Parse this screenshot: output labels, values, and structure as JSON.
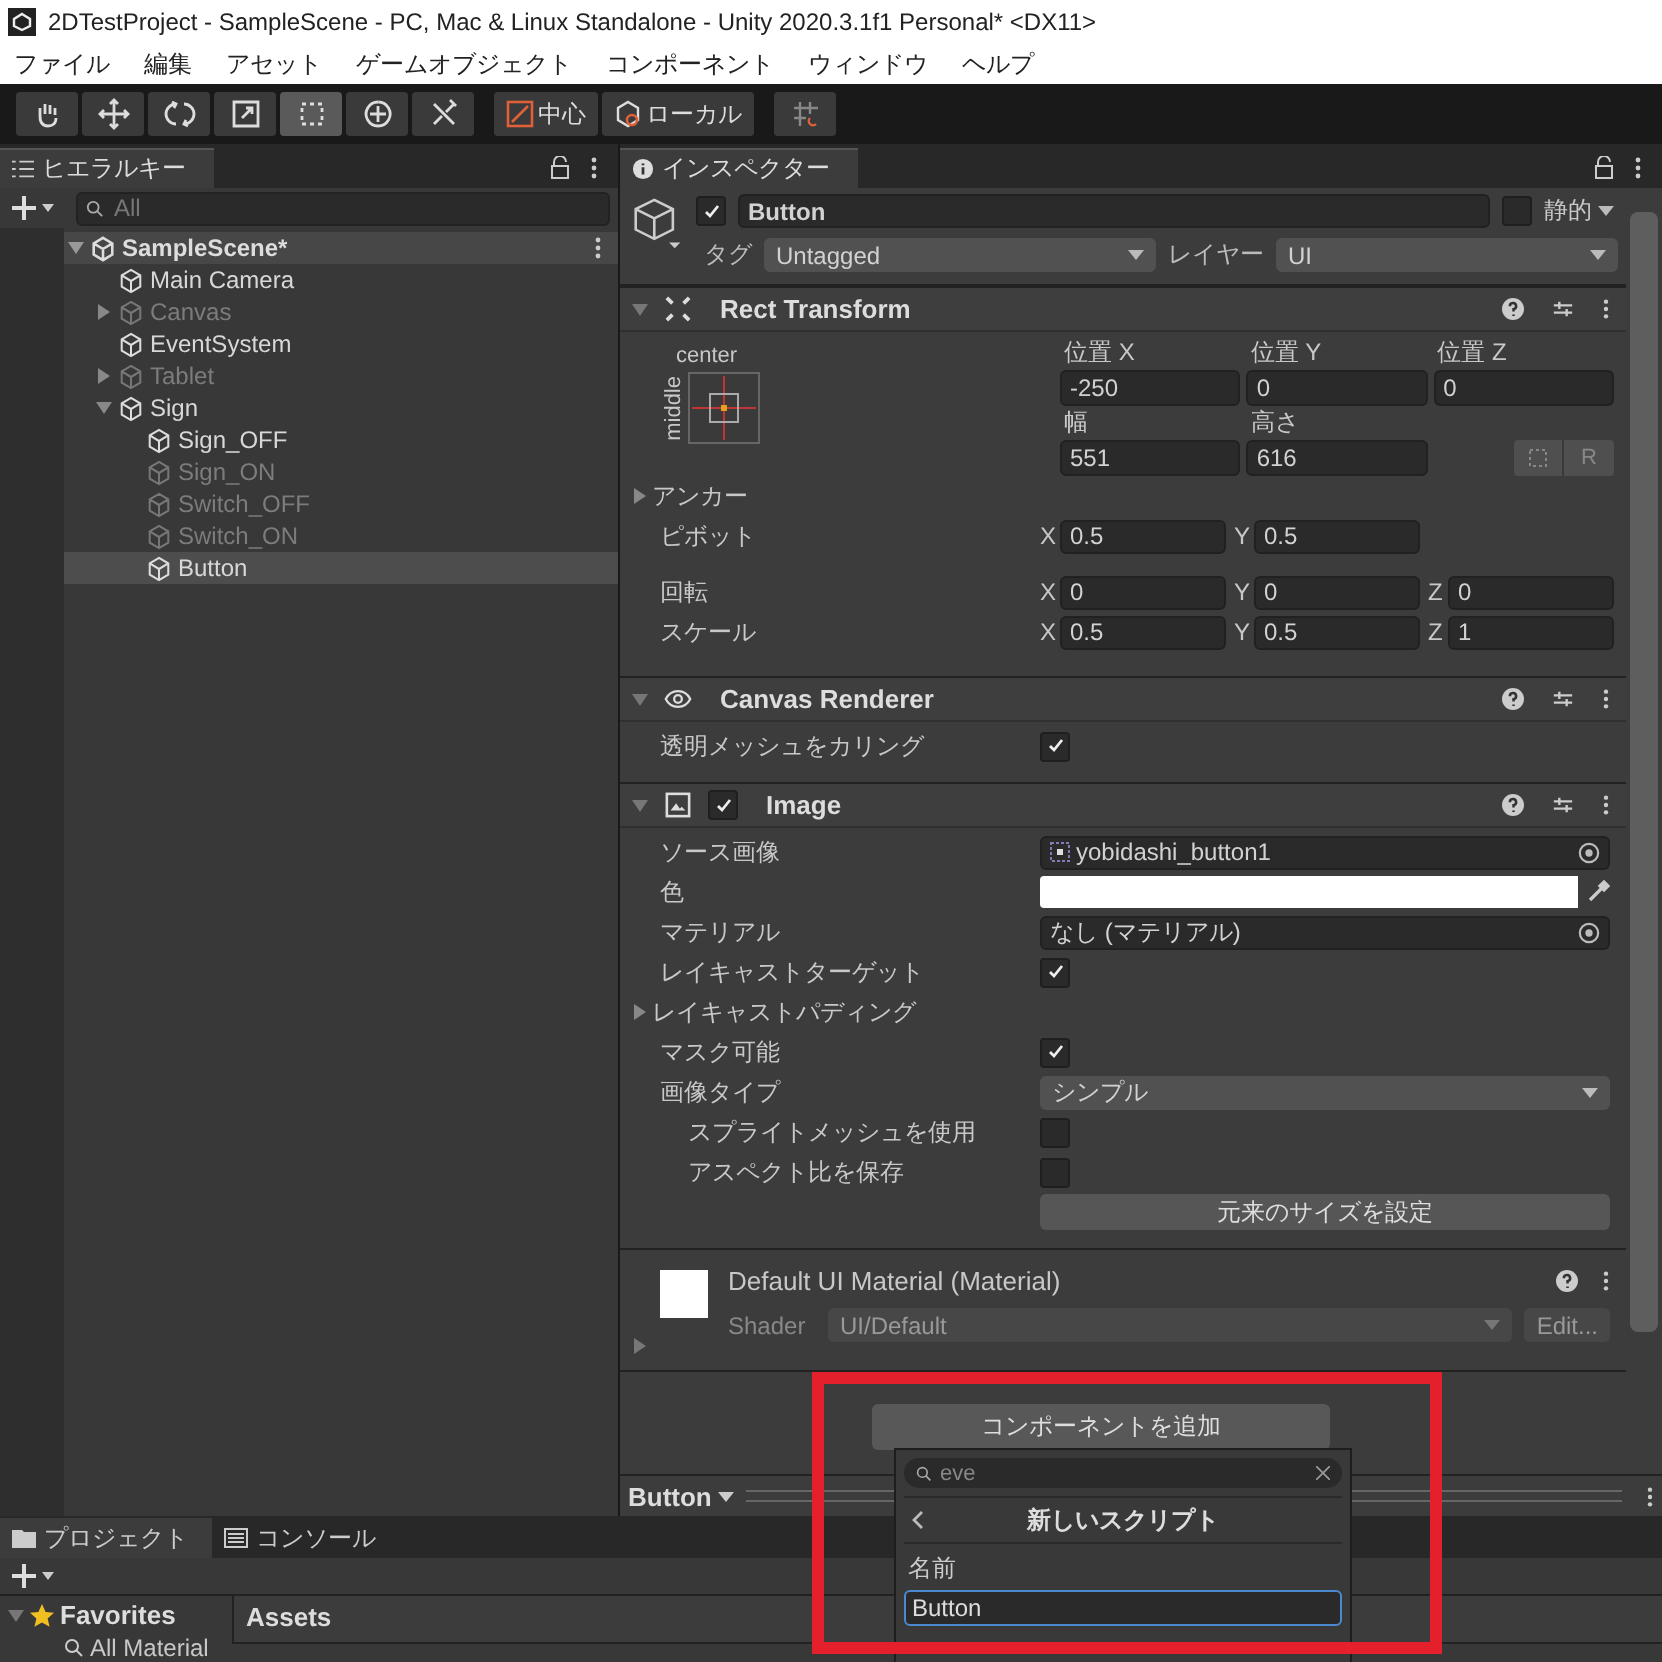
{
  "window": {
    "title": "2DTestProject - SampleScene - PC, Mac & Linux Standalone - Unity 2020.3.1f1 Personal* <DX11>"
  },
  "menu": [
    "ファイル",
    "編集",
    "アセット",
    "ゲームオブジェクト",
    "コンポーネント",
    "ウィンドウ",
    "ヘルプ"
  ],
  "toolbar": {
    "tools": [
      {
        "kind": "hand",
        "selected": false
      },
      {
        "kind": "move",
        "selected": false
      },
      {
        "kind": "rotate",
        "selected": false
      },
      {
        "kind": "scale",
        "selected": false
      },
      {
        "kind": "rect",
        "selected": true
      },
      {
        "kind": "transform",
        "selected": false
      },
      {
        "kind": "custom",
        "selected": false
      }
    ],
    "pivot": [
      {
        "kind": "pivot",
        "label": "中心"
      },
      {
        "kind": "local",
        "label": "ローカル"
      }
    ]
  },
  "hierarchy": {
    "tab": "ヒエラルキー",
    "search": {
      "placeholder": "All"
    },
    "scene": {
      "name": "SampleScene*",
      "expanded": true
    },
    "items": [
      {
        "name": "Main Camera",
        "active": true,
        "selected": false
      },
      {
        "name": "Canvas",
        "active": false,
        "selected": false,
        "expanded": false
      },
      {
        "name": "EventSystem",
        "active": true,
        "selected": false
      },
      {
        "name": "Tablet",
        "active": false,
        "selected": false,
        "expanded": false
      },
      {
        "name": "Sign",
        "active": true,
        "selected": false,
        "expanded": true,
        "children": [
          {
            "name": "Sign_OFF",
            "active": true,
            "selected": false
          },
          {
            "name": "Sign_ON",
            "active": false,
            "selected": false
          },
          {
            "name": "Switch_OFF",
            "active": false,
            "selected": false
          },
          {
            "name": "Switch_ON",
            "active": false,
            "selected": false
          },
          {
            "name": "Button",
            "active": true,
            "selected": true
          }
        ]
      }
    ]
  },
  "inspector": {
    "tab": "インスペクター",
    "object": {
      "name": "Button",
      "active": true,
      "static": false,
      "static_label": "静的",
      "tag_label": "タグ",
      "tag": "Untagged",
      "layer_label": "レイヤー",
      "layer": "UI"
    },
    "components": [
      {
        "kind": "rect_transform",
        "title": "Rect Transform",
        "expanded": true,
        "anchor": {
          "horizontal": "center",
          "vertical": "middle"
        },
        "position": [
          {
            "label": "位置 X",
            "value": "-250"
          },
          {
            "label": "位置 Y",
            "value": "0"
          },
          {
            "label": "位置 Z",
            "value": "0"
          }
        ],
        "size": [
          {
            "label": "幅",
            "value": "551"
          },
          {
            "label": "高さ",
            "value": "616"
          }
        ],
        "raw_button": "R",
        "rows": [
          {
            "kind": "foldout",
            "label": "アンカー"
          },
          {
            "kind": "vector",
            "label": "ピボット",
            "values": [
              {
                "axis": "X",
                "value": "0.5"
              },
              {
                "axis": "Y",
                "value": "0.5"
              }
            ]
          },
          {
            "kind": "vector",
            "label": "回転",
            "values": [
              {
                "axis": "X",
                "value": "0"
              },
              {
                "axis": "Y",
                "value": "0"
              },
              {
                "axis": "Z",
                "value": "0"
              }
            ]
          },
          {
            "kind": "vector",
            "label": "スケール",
            "values": [
              {
                "axis": "X",
                "value": "0.5"
              },
              {
                "axis": "Y",
                "value": "0.5"
              },
              {
                "axis": "Z",
                "value": "1"
              }
            ]
          }
        ]
      },
      {
        "kind": "canvas_renderer",
        "title": "Canvas Renderer",
        "expanded": true,
        "properties": [
          {
            "kind": "checkbox",
            "label": "透明メッシュをカリング",
            "checked": true,
            "indented": false
          }
        ]
      },
      {
        "kind": "image",
        "title": "Image",
        "expanded": true,
        "enabled": true,
        "properties": [
          {
            "kind": "object",
            "label": "ソース画像",
            "value": "yobidashi_button1",
            "sprite": true,
            "indented": false
          },
          {
            "kind": "color",
            "label": "色",
            "color": "#ffffff",
            "indented": false
          },
          {
            "kind": "object",
            "label": "マテリアル",
            "value": "なし (マテリアル)",
            "sprite": false,
            "indented": false
          },
          {
            "kind": "checkbox",
            "label": "レイキャストターゲット",
            "checked": true,
            "indented": false
          },
          {
            "kind": "foldout",
            "label": "レイキャストパディング",
            "indented": false
          },
          {
            "kind": "checkbox",
            "label": "マスク可能",
            "checked": true,
            "indented": false
          },
          {
            "kind": "dropdown",
            "label": "画像タイプ",
            "value": "シンプル",
            "indented": false
          },
          {
            "kind": "checkbox",
            "label": "スプライトメッシュを使用",
            "checked": false,
            "indented": true
          },
          {
            "kind": "checkbox",
            "label": "アスペクト比を保存",
            "checked": false,
            "indented": true
          },
          {
            "kind": "button",
            "label": "元来のサイズを設定",
            "indented": false
          }
        ]
      },
      {
        "kind": "material",
        "title": "Default UI Material (Material)",
        "expanded": false,
        "shader_label": "Shader",
        "shader": "UI/Default",
        "edit_button": "Edit..."
      }
    ],
    "add_component": "コンポーネントを追加",
    "preview": "Button"
  },
  "popup": {
    "search": "eve",
    "title": "新しいスクリプト",
    "name_label": "名前",
    "name_value": "Button"
  },
  "project": {
    "tabs": [
      {
        "label": "プロジェクト",
        "kind": "project",
        "selected": true
      },
      {
        "label": "コンソール",
        "kind": "console",
        "selected": false
      }
    ],
    "favorites": "Favorites",
    "favorite_items": [
      "All Material"
    ],
    "assets": "Assets"
  }
}
